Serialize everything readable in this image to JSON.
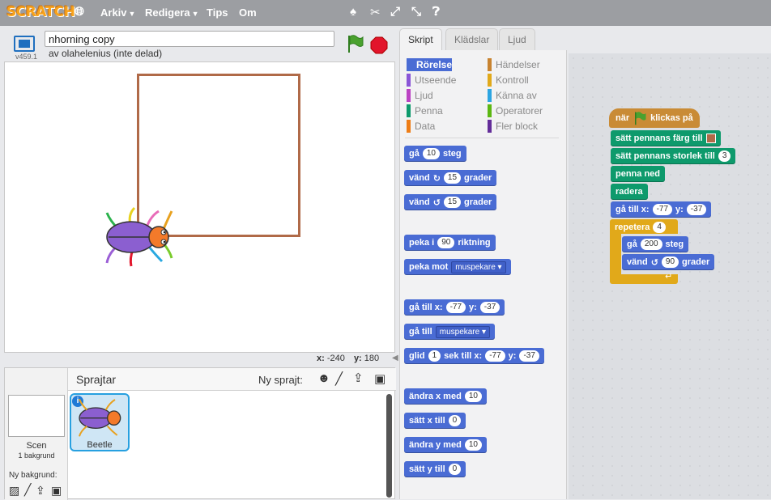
{
  "menubar": {
    "logo": "SCRATCH",
    "arkiv": "Arkiv",
    "redigera": "Redigera",
    "tips": "Tips",
    "om": "Om"
  },
  "stage": {
    "version": "v459.1",
    "project_title": "nhorning copy",
    "owner": "av olahelenius (inte delad)",
    "x_label": "x:",
    "x_value": "-240",
    "y_label": "y:",
    "y_value": "180"
  },
  "sprites": {
    "title": "Sprajtar",
    "new_sprite": "Ny sprajt:",
    "scene_label": "Scen",
    "scene_sub": "1 bakgrund",
    "new_bg": "Ny bakgrund:",
    "sprite_name": "Beetle"
  },
  "tabs": [
    "Skript",
    "Klädslar",
    "Ljud"
  ],
  "categories": [
    {
      "label": "Rörelse",
      "color": "#4a6cd4"
    },
    {
      "label": "Utseende",
      "color": "#8a55d7"
    },
    {
      "label": "Ljud",
      "color": "#bb42c3"
    },
    {
      "label": "Penna",
      "color": "#0e9a6c"
    },
    {
      "label": "Data",
      "color": "#ee7d16"
    },
    {
      "label": "Händelser",
      "color": "#c88330"
    },
    {
      "label": "Kontroll",
      "color": "#e1a91a"
    },
    {
      "label": "Känna av",
      "color": "#2ca5e2"
    },
    {
      "label": "Operatorer",
      "color": "#5cb712"
    },
    {
      "label": "Fler block",
      "color": "#632d99"
    }
  ],
  "palette": {
    "ga": "gå",
    "steg": "steg",
    "steg_val": "10",
    "vand": "vänd",
    "grader": "grader",
    "vand_val": "15",
    "peka_i": "peka i",
    "riktning": "riktning",
    "peka_val": "90",
    "peka_mot": "peka mot",
    "muspekare": "muspekare",
    "ga_till_x": "gå till x:",
    "y": "y:",
    "x_val": "-77",
    "y_val": "-37",
    "ga_till": "gå till",
    "glid": "glid",
    "sek_till_x": "sek till x:",
    "glid_val": "1",
    "andra_x": "ändra x med",
    "satt_x": "sätt x till",
    "andra_y": "ändra y med",
    "satt_y": "sätt y till",
    "v10": "10",
    "v0": "0"
  },
  "script": {
    "hat_nar": "när",
    "hat_klickas": "klickas på",
    "pen_color": "sätt pennans färg till",
    "pen_size": "sätt pennans storlek till",
    "pen_size_val": "3",
    "pen_down": "penna ned",
    "clear": "radera",
    "goto_x": "gå till x:",
    "y": "y:",
    "x_val": "-77",
    "y_val": "-37",
    "repeat": "repetera",
    "repeat_val": "4",
    "move": "gå",
    "move_val": "200",
    "steg": "steg",
    "turn": "vänd",
    "turn_val": "90",
    "grader": "grader"
  }
}
